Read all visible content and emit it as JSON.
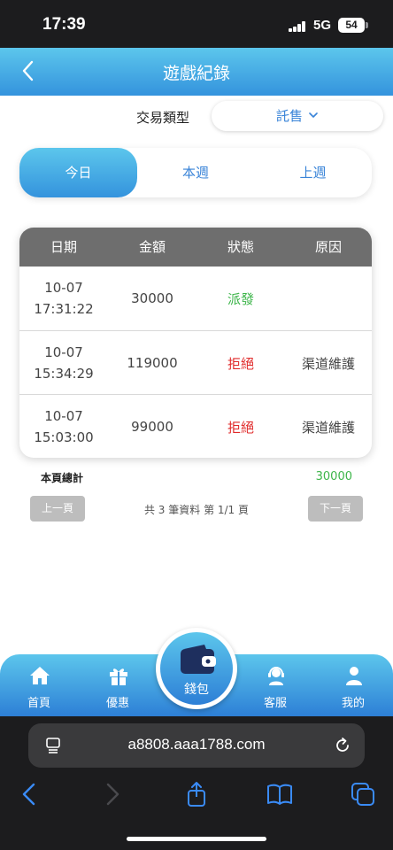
{
  "status_bar": {
    "time": "17:39",
    "network": "5G",
    "battery": "54"
  },
  "header": {
    "title": "遊戲紀錄",
    "back_icon": "chevron-left-icon"
  },
  "filter": {
    "label": "交易類型",
    "selected": "託售"
  },
  "tabs": [
    {
      "label": "今日",
      "active": true
    },
    {
      "label": "本週",
      "active": false
    },
    {
      "label": "上週",
      "active": false
    }
  ],
  "table": {
    "columns": [
      "日期",
      "金額",
      "狀態",
      "原因"
    ],
    "rows": [
      {
        "date": "10-07",
        "time": "17:31:22",
        "amount": "30000",
        "status": "派發",
        "reason": ""
      },
      {
        "date": "10-07",
        "time": "15:34:29",
        "amount": "119000",
        "status": "拒絕",
        "reason": "渠道維護"
      },
      {
        "date": "10-07",
        "time": "15:03:00",
        "amount": "99000",
        "status": "拒絕",
        "reason": "渠道維護"
      }
    ]
  },
  "summary": {
    "label": "本頁總計",
    "value": "30000"
  },
  "pagination": {
    "prev_label": "上一頁",
    "next_label": "下一頁",
    "info": "共 3 筆資料 第 1/1 頁"
  },
  "bottom_nav": {
    "items": [
      {
        "label": "首頁",
        "icon": "home-icon"
      },
      {
        "label": "優惠",
        "icon": "gift-icon"
      },
      {
        "label": "錢包",
        "icon": "wallet-icon"
      },
      {
        "label": "客服",
        "icon": "headset-icon"
      },
      {
        "label": "我的",
        "icon": "user-icon"
      }
    ]
  },
  "browser": {
    "url": "a8808.aaa1788.com"
  },
  "colors": {
    "accent": "#3493dd",
    "accent_light": "#5cc6ec",
    "green": "#3db54a",
    "red": "#e02a2a",
    "table_header": "#6e6e6e"
  }
}
